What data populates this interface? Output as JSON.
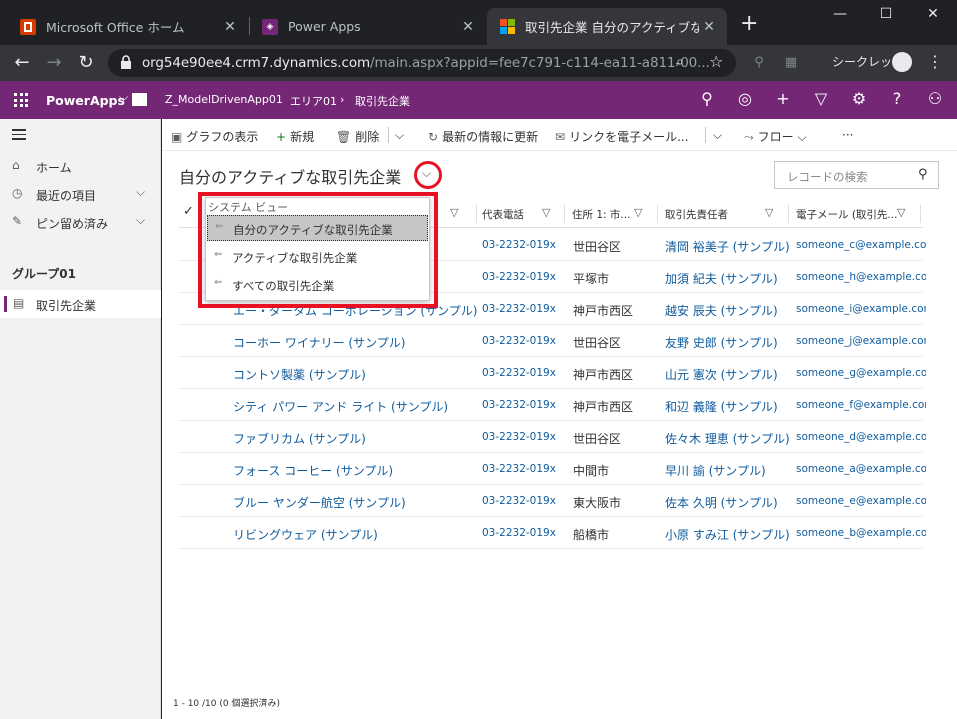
{
  "browser": {
    "tabs": [
      {
        "title": "Microsoft Office ホーム",
        "active": false
      },
      {
        "title": "Power Apps",
        "active": false
      },
      {
        "title": "取引先企業 自分のアクティブな取引",
        "active": true
      }
    ],
    "url_host": "org54e90ee4.crm7.dynamics.com",
    "url_path": "/main.aspx?appid=fee7c791-c114-ea11-a811-00...",
    "incognito_label": "シークレット"
  },
  "app": {
    "brand": "PowerApps",
    "breadcrumb": [
      "Z_ModelDrivenApp01",
      "エリア01",
      "取引先企業"
    ],
    "header_color": "#742774"
  },
  "nav": {
    "items": [
      {
        "label": "ホーム",
        "icon": "home-icon"
      },
      {
        "label": "最近の項目",
        "icon": "clock-icon"
      },
      {
        "label": "ピン留め済み",
        "icon": "pin-icon"
      }
    ],
    "group": "グループ01",
    "active_item": "取引先企業"
  },
  "commands": [
    "グラフの表示",
    "新規",
    "削除",
    "最新の情報に更新",
    "リンクを電子メール...",
    "フロー"
  ],
  "view": {
    "title": "自分のアクティブな取引先企業",
    "search_placeholder": "レコードの検索",
    "dropdown_header": "システム ビュー",
    "options": [
      "自分のアクティブな取引先企業",
      "アクティブな取引先企業",
      "すべての取引先企業"
    ]
  },
  "grid": {
    "columns": [
      "代表電話",
      "住所 1: 市...",
      "取引先責任者",
      "電子メール (取引先..."
    ],
    "rows": [
      {
        "name": "",
        "phone": "03-2232-019x",
        "city": "世田谷区",
        "contact": "清岡 裕美子 (サンプル)",
        "email": "someone_c@example.com"
      },
      {
        "name": "",
        "phone": "03-2232-019x",
        "city": "平塚市",
        "contact": "加須 紀夫 (サンプル)",
        "email": "someone_h@example.com"
      },
      {
        "name": "エー・ダータム コーポレーション (サンプル)",
        "phone": "03-2232-019x",
        "city": "神戸市西区",
        "contact": "越安 辰夫 (サンプル)",
        "email": "someone_i@example.com"
      },
      {
        "name": "コーホー ワイナリー (サンプル)",
        "phone": "03-2232-019x",
        "city": "世田谷区",
        "contact": "友野 史郎 (サンプル)",
        "email": "someone_j@example.com"
      },
      {
        "name": "コントソ製薬 (サンプル)",
        "phone": "03-2232-019x",
        "city": "神戸市西区",
        "contact": "山元 憲次 (サンプル)",
        "email": "someone_g@example.com"
      },
      {
        "name": "シティ パワー アンド ライト (サンプル)",
        "phone": "03-2232-019x",
        "city": "神戸市西区",
        "contact": "和辺 義隆 (サンプル)",
        "email": "someone_f@example.com"
      },
      {
        "name": "ファブリカム (サンプル)",
        "phone": "03-2232-019x",
        "city": "世田谷区",
        "contact": "佐々木 理恵 (サンプル)",
        "email": "someone_d@example.com"
      },
      {
        "name": "フォース コーヒー (サンプル)",
        "phone": "03-2232-019x",
        "city": "中間市",
        "contact": "早川 諭 (サンプル)",
        "email": "someone_a@example.com"
      },
      {
        "name": "ブルー ヤンダー航空 (サンプル)",
        "phone": "03-2232-019x",
        "city": "東大阪市",
        "contact": "佐本 久明 (サンプル)",
        "email": "someone_e@example.com"
      },
      {
        "name": "リビングウェア (サンプル)",
        "phone": "03-2232-019x",
        "city": "船橋市",
        "contact": "小原 すみ江 (サンプル)",
        "email": "someone_b@example.com"
      }
    ],
    "footer": "1 - 10 /10 (0 個選択済み)"
  }
}
